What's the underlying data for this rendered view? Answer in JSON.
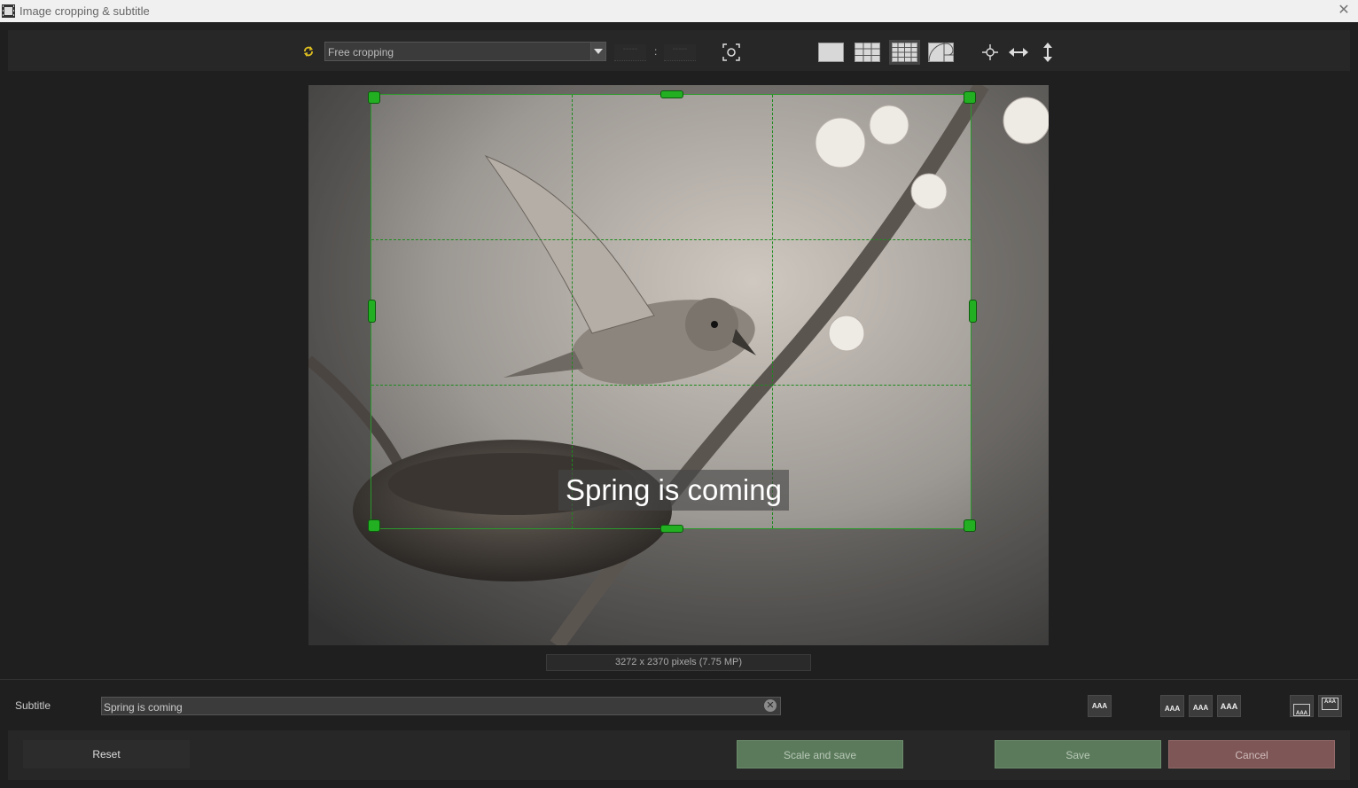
{
  "window": {
    "title": "Image cropping & subtitle",
    "close_symbol": "✕"
  },
  "toolbar": {
    "crop_mode": "Free cropping",
    "ratio_width": "-----",
    "ratio_separator": ":",
    "ratio_height": "-----"
  },
  "image": {
    "size_text": "3272 x 2370 pixels (7.75 MP)"
  },
  "subtitle": {
    "label": "Subtitle",
    "value": "Spring is coming",
    "overlay_text": "Spring is coming",
    "style_glyph": "AAA"
  },
  "footer": {
    "reset": "Reset",
    "scale_and_save": "Scale and save",
    "save": "Save",
    "cancel": "Cancel"
  },
  "colors": {
    "crop_guides": "#1d8a1d",
    "crop_handles": "#22b022",
    "save_button": "#5b7a5b",
    "cancel_button": "#7e5656"
  }
}
